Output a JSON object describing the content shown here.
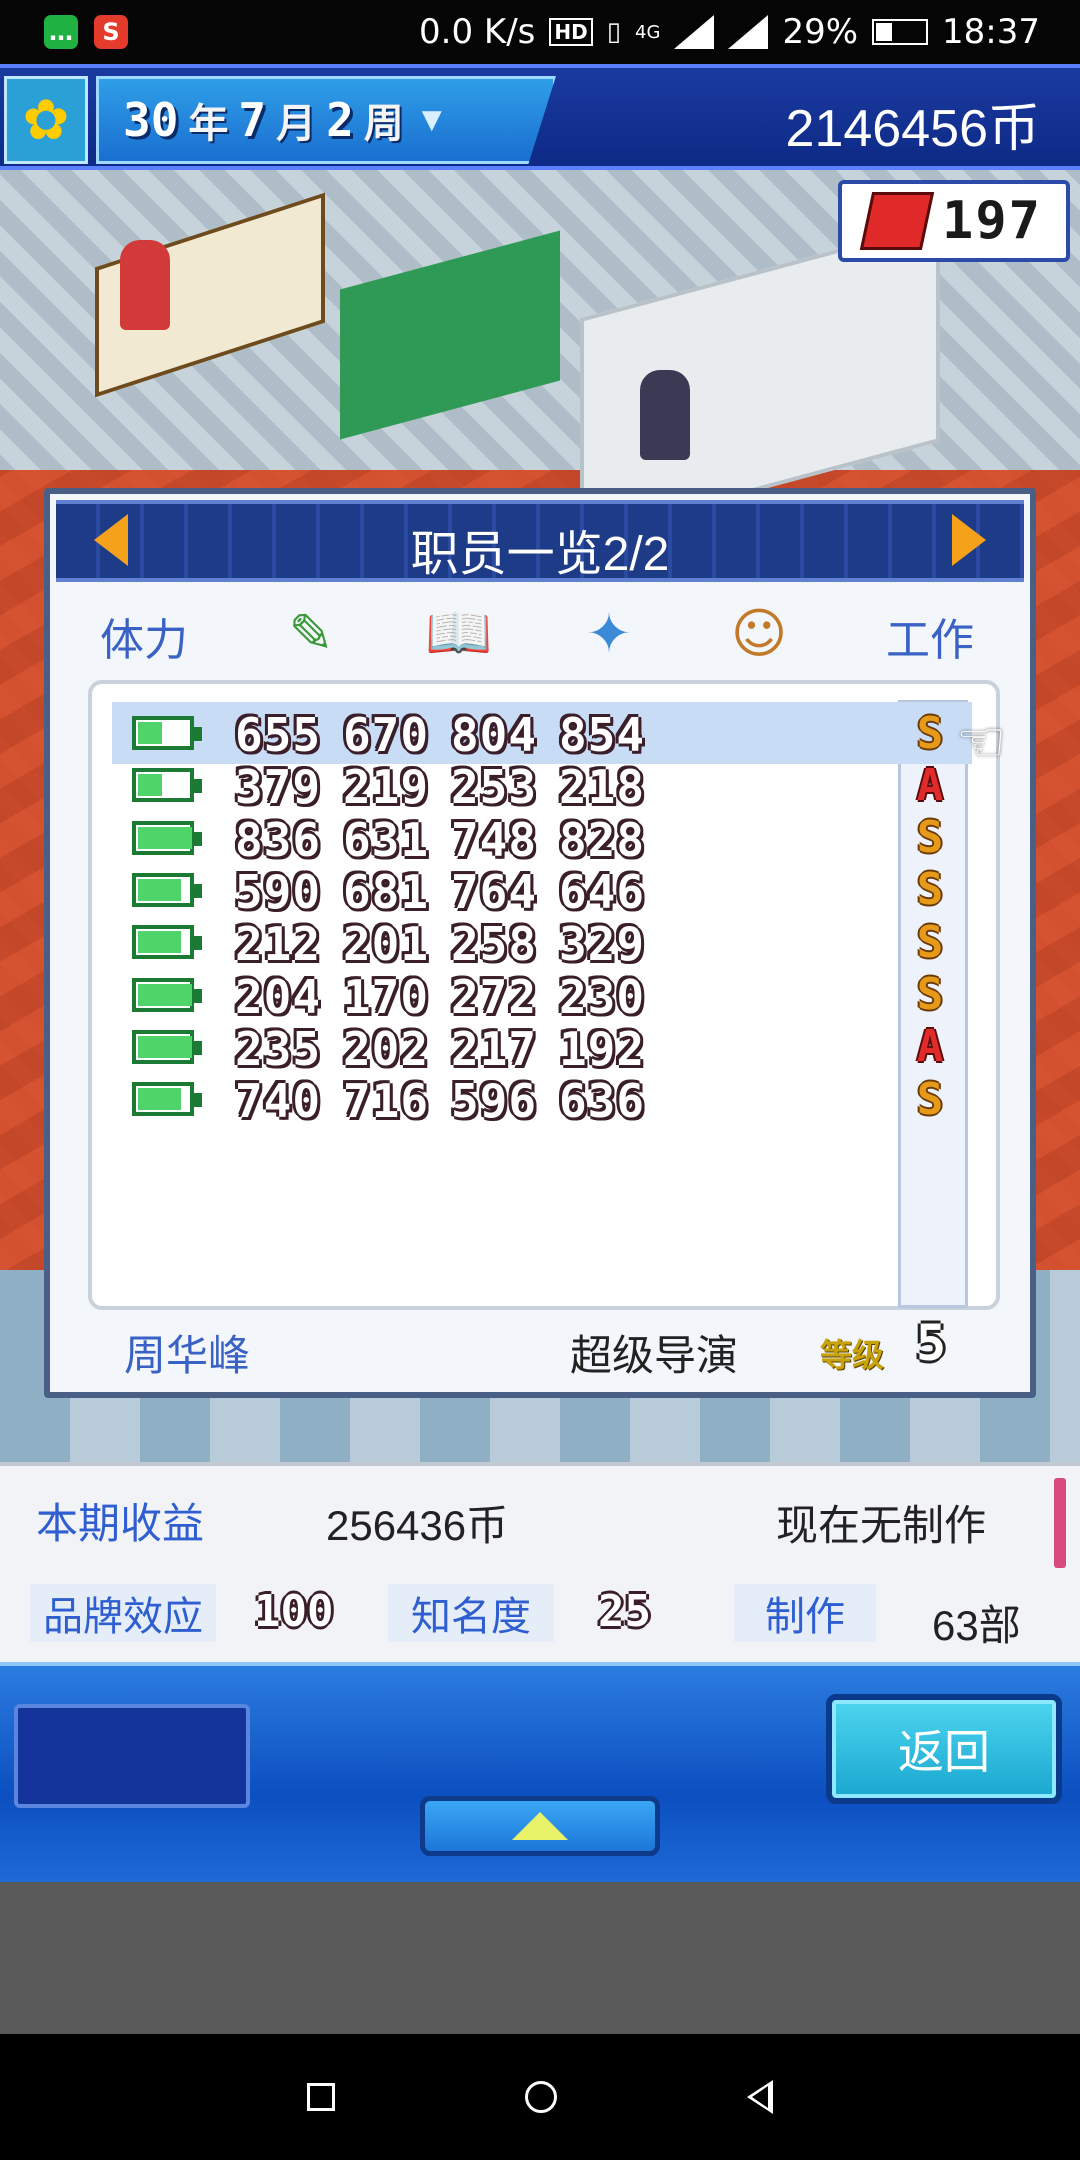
{
  "status_bar": {
    "net_speed": "0.0 K/s",
    "hd_badge": "HD",
    "network": "4G",
    "battery_percent": "29%",
    "time": "18:37",
    "app_icons": [
      "message-icon",
      "s-app-icon"
    ]
  },
  "top_bar": {
    "year": "30",
    "year_unit": "年",
    "month": "7",
    "month_unit": "月",
    "week": "2",
    "week_unit": "周",
    "money": "2146456币",
    "tickets": "197"
  },
  "staff_dialog": {
    "title": "职员一览2/2",
    "headers": {
      "stamina": "体力",
      "work": "工作",
      "icons": [
        "pencil-icon",
        "book-icon",
        "fan-icon",
        "actor-icon"
      ]
    },
    "rows": [
      {
        "battery": 0.45,
        "stats": [
          "655",
          "670",
          "804",
          "854"
        ],
        "rank": "S",
        "selected": true
      },
      {
        "battery": 0.45,
        "stats": [
          "379",
          "219",
          "253",
          "218"
        ],
        "rank": "A"
      },
      {
        "battery": 1.0,
        "stats": [
          "836",
          "631",
          "748",
          "828"
        ],
        "rank": "S"
      },
      {
        "battery": 0.8,
        "stats": [
          "590",
          "681",
          "764",
          "646"
        ],
        "rank": "S"
      },
      {
        "battery": 0.8,
        "stats": [
          "212",
          "201",
          "258",
          "329"
        ],
        "rank": "S"
      },
      {
        "battery": 1.0,
        "stats": [
          "204",
          "170",
          "272",
          "230"
        ],
        "rank": "S"
      },
      {
        "battery": 1.0,
        "stats": [
          "235",
          "202",
          "217",
          "192"
        ],
        "rank": "A"
      },
      {
        "battery": 0.8,
        "stats": [
          "740",
          "716",
          "596",
          "636"
        ],
        "rank": "S"
      }
    ],
    "footer": {
      "name": "周华峰",
      "role": "超级导演",
      "level_label": "等级",
      "level_value": "5"
    }
  },
  "info_bar": {
    "income_label": "本期收益",
    "income_value": "256436币",
    "production_status": "现在无制作",
    "brand_label": "品牌效应",
    "brand_value": "100",
    "fame_label": "知名度",
    "fame_value": "25",
    "produce_label": "制作",
    "produce_count": "63部"
  },
  "controls": {
    "back_label": "返回"
  },
  "colors": {
    "accent_blue": "#2f5ed0",
    "rank_s": "#e59a1a",
    "rank_a": "#e12b2b",
    "battery_green": "#4fd46a"
  }
}
